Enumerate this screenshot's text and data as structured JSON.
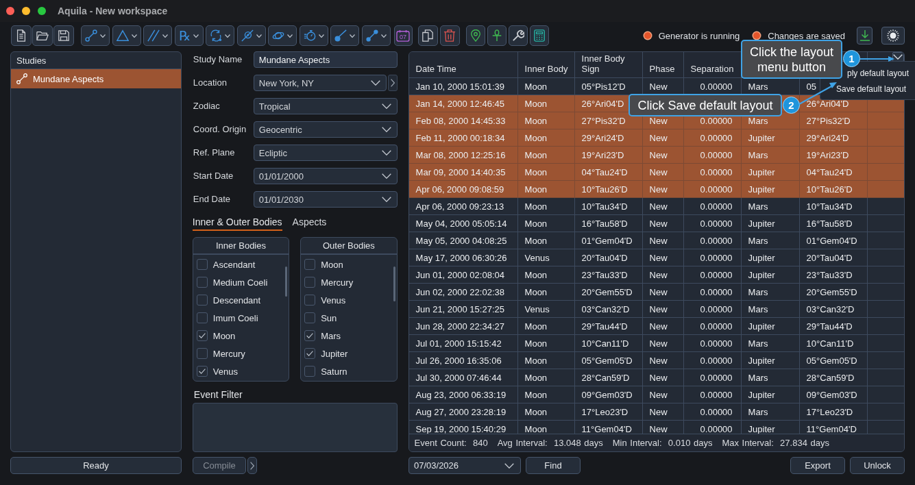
{
  "window": {
    "title": "Aquila - New workspace"
  },
  "toolbar": {
    "retrograde_glyph": "℞",
    "calendar_day": "07"
  },
  "status_indicators": [
    {
      "label": "Generator is running"
    },
    {
      "label": "Changes are saved"
    }
  ],
  "studies": {
    "title": "Studies",
    "items": [
      {
        "label": "Mundane Aspects",
        "selected": true
      }
    ]
  },
  "status_button": "Ready",
  "study_form": [
    {
      "kind": "text",
      "label": "Study Name",
      "value": "Mundane Aspects"
    },
    {
      "kind": "select_more",
      "label": "Location",
      "value": "New York, NY"
    },
    {
      "kind": "select",
      "label": "Zodiac",
      "value": "Tropical"
    },
    {
      "kind": "select",
      "label": "Coord. Origin",
      "value": "Geocentric"
    },
    {
      "kind": "select",
      "label": "Ref. Plane",
      "value": "Ecliptic"
    },
    {
      "kind": "select",
      "label": "Start Date",
      "value": "01/01/2000"
    },
    {
      "kind": "select",
      "label": "End Date",
      "value": "01/01/2030"
    }
  ],
  "tabs": [
    {
      "label": "Inner & Outer Bodies",
      "selected": true
    },
    {
      "label": "Aspects",
      "selected": false
    }
  ],
  "body_lists": [
    {
      "title": "Inner Bodies",
      "items": [
        {
          "label": "Ascendant",
          "checked": false
        },
        {
          "label": "Medium Coeli",
          "checked": false
        },
        {
          "label": "Descendant",
          "checked": false
        },
        {
          "label": "Imum Coeli",
          "checked": false
        },
        {
          "label": "Moon",
          "checked": true
        },
        {
          "label": "Mercury",
          "checked": false
        },
        {
          "label": "Venus",
          "checked": true
        }
      ]
    },
    {
      "title": "Outer Bodies",
      "items": [
        {
          "label": "Moon",
          "checked": false
        },
        {
          "label": "Mercury",
          "checked": false
        },
        {
          "label": "Venus",
          "checked": false
        },
        {
          "label": "Sun",
          "checked": false
        },
        {
          "label": "Mars",
          "checked": true
        },
        {
          "label": "Jupiter",
          "checked": true
        },
        {
          "label": "Saturn",
          "checked": false
        }
      ]
    }
  ],
  "event_filter": {
    "label": "Event Filter"
  },
  "compile_button": {
    "label": "Compile",
    "disabled": true
  },
  "table": {
    "columns": [
      "Date Time",
      "Inner Body",
      "Inner Body Sign",
      "Phase",
      "Separation"
    ],
    "rows": [
      {
        "selected": false,
        "date_time": "Jan 10, 2000 15:01:39",
        "inner_body": "Moon",
        "inner_body_sign": "05°Pis12'D",
        "phase": "New",
        "separation": "0.00000",
        "column_6": "Mars",
        "column_7": "05"
      },
      {
        "selected": true,
        "date_time": "Jan 14, 2000 12:46:45",
        "inner_body": "Moon",
        "inner_body_sign": "26°Ari04'D",
        "column_7": "26°Ari04'D"
      },
      {
        "selected": true,
        "date_time": "Feb 08, 2000 14:45:33",
        "inner_body": "Moon",
        "inner_body_sign": "27°Pis32'D",
        "phase": "New",
        "separation": "0.00000",
        "column_6": "Mars",
        "column_7": "27°Pis32'D"
      },
      {
        "selected": true,
        "date_time": "Feb 11, 2000 00:18:34",
        "inner_body": "Moon",
        "inner_body_sign": "29°Ari24'D",
        "phase": "New",
        "separation": "0.00000",
        "column_6": "Jupiter",
        "column_7": "29°Ari24'D"
      },
      {
        "selected": true,
        "date_time": "Mar 08, 2000 12:25:16",
        "inner_body": "Moon",
        "inner_body_sign": "19°Ari23'D",
        "phase": "New",
        "separation": "0.00000",
        "column_6": "Mars",
        "column_7": "19°Ari23'D"
      },
      {
        "selected": true,
        "date_time": "Mar 09, 2000 14:40:35",
        "inner_body": "Moon",
        "inner_body_sign": "04°Tau24'D",
        "phase": "New",
        "separation": "0.00000",
        "column_6": "Jupiter",
        "column_7": "04°Tau24'D"
      },
      {
        "selected": true,
        "date_time": "Apr 06, 2000 09:08:59",
        "inner_body": "Moon",
        "inner_body_sign": "10°Tau26'D",
        "phase": "New",
        "separation": "0.00000",
        "column_6": "Jupiter",
        "column_7": "10°Tau26'D"
      },
      {
        "selected": false,
        "date_time": "Apr 06, 2000 09:23:13",
        "inner_body": "Moon",
        "inner_body_sign": "10°Tau34'D",
        "phase": "New",
        "separation": "0.00000",
        "column_6": "Mars",
        "column_7": "10°Tau34'D"
      },
      {
        "selected": false,
        "date_time": "May 04, 2000 05:05:14",
        "inner_body": "Moon",
        "inner_body_sign": "16°Tau58'D",
        "phase": "New",
        "separation": "0.00000",
        "column_6": "Jupiter",
        "column_7": "16°Tau58'D"
      },
      {
        "selected": false,
        "date_time": "May 05, 2000 04:08:25",
        "inner_body": "Moon",
        "inner_body_sign": "01°Gem04'D",
        "phase": "New",
        "separation": "0.00000",
        "column_6": "Mars",
        "column_7": "01°Gem04'D"
      },
      {
        "selected": false,
        "date_time": "May 17, 2000 06:30:26",
        "inner_body": "Venus",
        "inner_body_sign": "20°Tau04'D",
        "phase": "New",
        "separation": "0.00000",
        "column_6": "Jupiter",
        "column_7": "20°Tau04'D"
      },
      {
        "selected": false,
        "date_time": "Jun 01, 2000 02:08:04",
        "inner_body": "Moon",
        "inner_body_sign": "23°Tau33'D",
        "phase": "New",
        "separation": "0.00000",
        "column_6": "Jupiter",
        "column_7": "23°Tau33'D"
      },
      {
        "selected": false,
        "date_time": "Jun 02, 2000 22:02:38",
        "inner_body": "Moon",
        "inner_body_sign": "20°Gem55'D",
        "phase": "New",
        "separation": "0.00000",
        "column_6": "Mars",
        "column_7": "20°Gem55'D"
      },
      {
        "selected": false,
        "date_time": "Jun 21, 2000 15:27:25",
        "inner_body": "Venus",
        "inner_body_sign": "03°Can32'D",
        "phase": "New",
        "separation": "0.00000",
        "column_6": "Mars",
        "column_7": "03°Can32'D"
      },
      {
        "selected": false,
        "date_time": "Jun 28, 2000 22:34:27",
        "inner_body": "Moon",
        "inner_body_sign": "29°Tau44'D",
        "phase": "New",
        "separation": "0.00000",
        "column_6": "Jupiter",
        "column_7": "29°Tau44'D"
      },
      {
        "selected": false,
        "date_time": "Jul 01, 2000 15:15:42",
        "inner_body": "Moon",
        "inner_body_sign": "10°Can11'D",
        "phase": "New",
        "separation": "0.00000",
        "column_6": "Mars",
        "column_7": "10°Can11'D"
      },
      {
        "selected": false,
        "date_time": "Jul 26, 2000 16:35:06",
        "inner_body": "Moon",
        "inner_body_sign": "05°Gem05'D",
        "phase": "New",
        "separation": "0.00000",
        "column_6": "Jupiter",
        "column_7": "05°Gem05'D"
      },
      {
        "selected": false,
        "date_time": "Jul 30, 2000 07:46:44",
        "inner_body": "Moon",
        "inner_body_sign": "28°Can59'D",
        "phase": "New",
        "separation": "0.00000",
        "column_6": "Mars",
        "column_7": "28°Can59'D"
      },
      {
        "selected": false,
        "date_time": "Aug 23, 2000 06:33:19",
        "inner_body": "Moon",
        "inner_body_sign": "09°Gem03'D",
        "phase": "New",
        "separation": "0.00000",
        "column_6": "Jupiter",
        "column_7": "09°Gem03'D"
      },
      {
        "selected": false,
        "date_time": "Aug 27, 2000 23:28:19",
        "inner_body": "Moon",
        "inner_body_sign": "17°Leo23'D",
        "phase": "New",
        "separation": "0.00000",
        "column_6": "Mars",
        "column_7": "17°Leo23'D"
      },
      {
        "selected": false,
        "date_time": "Sep 19, 2000 15:40:29",
        "inner_body": "Moon",
        "inner_body_sign": "11°Gem04'D",
        "phase": "New",
        "separation": "0.00000",
        "column_6": "Jupiter",
        "column_7": "11°Gem04'D"
      }
    ],
    "stats": [
      {
        "label": "Event Count:",
        "value": "840"
      },
      {
        "label": "Avg Interval:",
        "value": "13.048 days"
      },
      {
        "label": "Min Interval:",
        "value": "0.010 days"
      },
      {
        "label": "Max Interval:",
        "value": "27.834 days"
      }
    ]
  },
  "date_picker": {
    "value": "07/03/2026"
  },
  "find_button": "Find",
  "action_buttons": [
    "Export",
    "Unlock"
  ],
  "layout_menu": {
    "items": [
      "ply default layout",
      "Save default layout"
    ]
  },
  "callouts": [
    {
      "number": "1",
      "text": "Click the layout menu button"
    },
    {
      "number": "2",
      "text": "Click Save default layout"
    }
  ]
}
